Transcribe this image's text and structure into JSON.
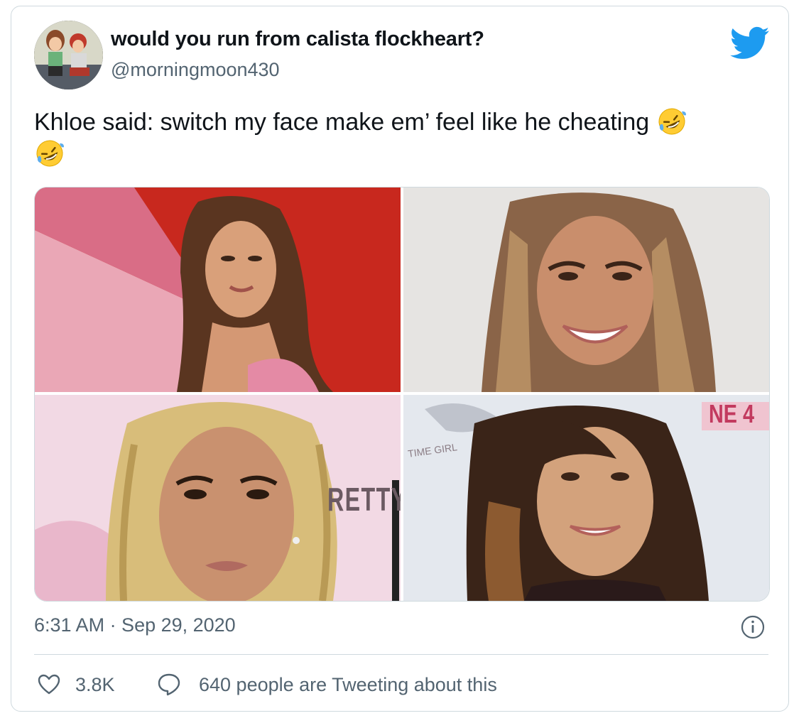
{
  "tweet": {
    "display_name": "would you run from calista flockheart?",
    "handle": "@morningmoon430",
    "text": "Khloe said: switch my face make em’ feel like he cheating",
    "timestamp": "6:31 AM · Sep 29, 2020",
    "like_count": "3.8K",
    "conversation_text": "640 people are Tweeting about this",
    "photos": [
      {
        "overlay": ""
      },
      {
        "overlay": ""
      },
      {
        "overlay": "RETTY"
      },
      {
        "overlay": "NE 4"
      }
    ],
    "photo_texts": {
      "p4_small": "TIME GIRL"
    },
    "icons": {
      "brand": "twitter-bird-icon",
      "info": "info-icon",
      "like": "heart-icon",
      "reply": "speech-bubble-icon",
      "emoji": "rolling-on-floor-laughing-emoji"
    },
    "colors": {
      "brand": "#1d9bf0",
      "secondary_text": "#536471",
      "border": "#cfd9de"
    }
  }
}
